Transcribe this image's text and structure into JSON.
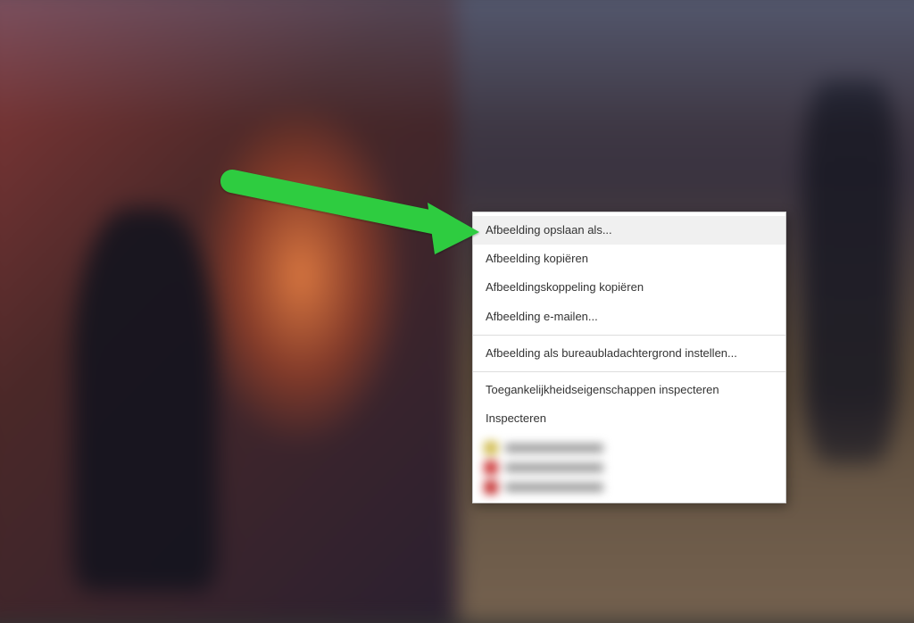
{
  "context_menu": {
    "items": [
      {
        "label": "Afbeelding opslaan als...",
        "highlighted": true
      },
      {
        "label": "Afbeelding kopiëren",
        "highlighted": false
      },
      {
        "label": "Afbeeldingskoppeling kopiëren",
        "highlighted": false
      },
      {
        "label": "Afbeelding e-mailen...",
        "highlighted": false
      },
      {
        "separator": true
      },
      {
        "label": "Afbeelding als bureaubladachtergrond instellen...",
        "highlighted": false
      },
      {
        "separator": true
      },
      {
        "label": "Toegankelijkheidseigenschappen inspecteren",
        "highlighted": false
      },
      {
        "label": "Inspecteren",
        "highlighted": false
      }
    ]
  }
}
